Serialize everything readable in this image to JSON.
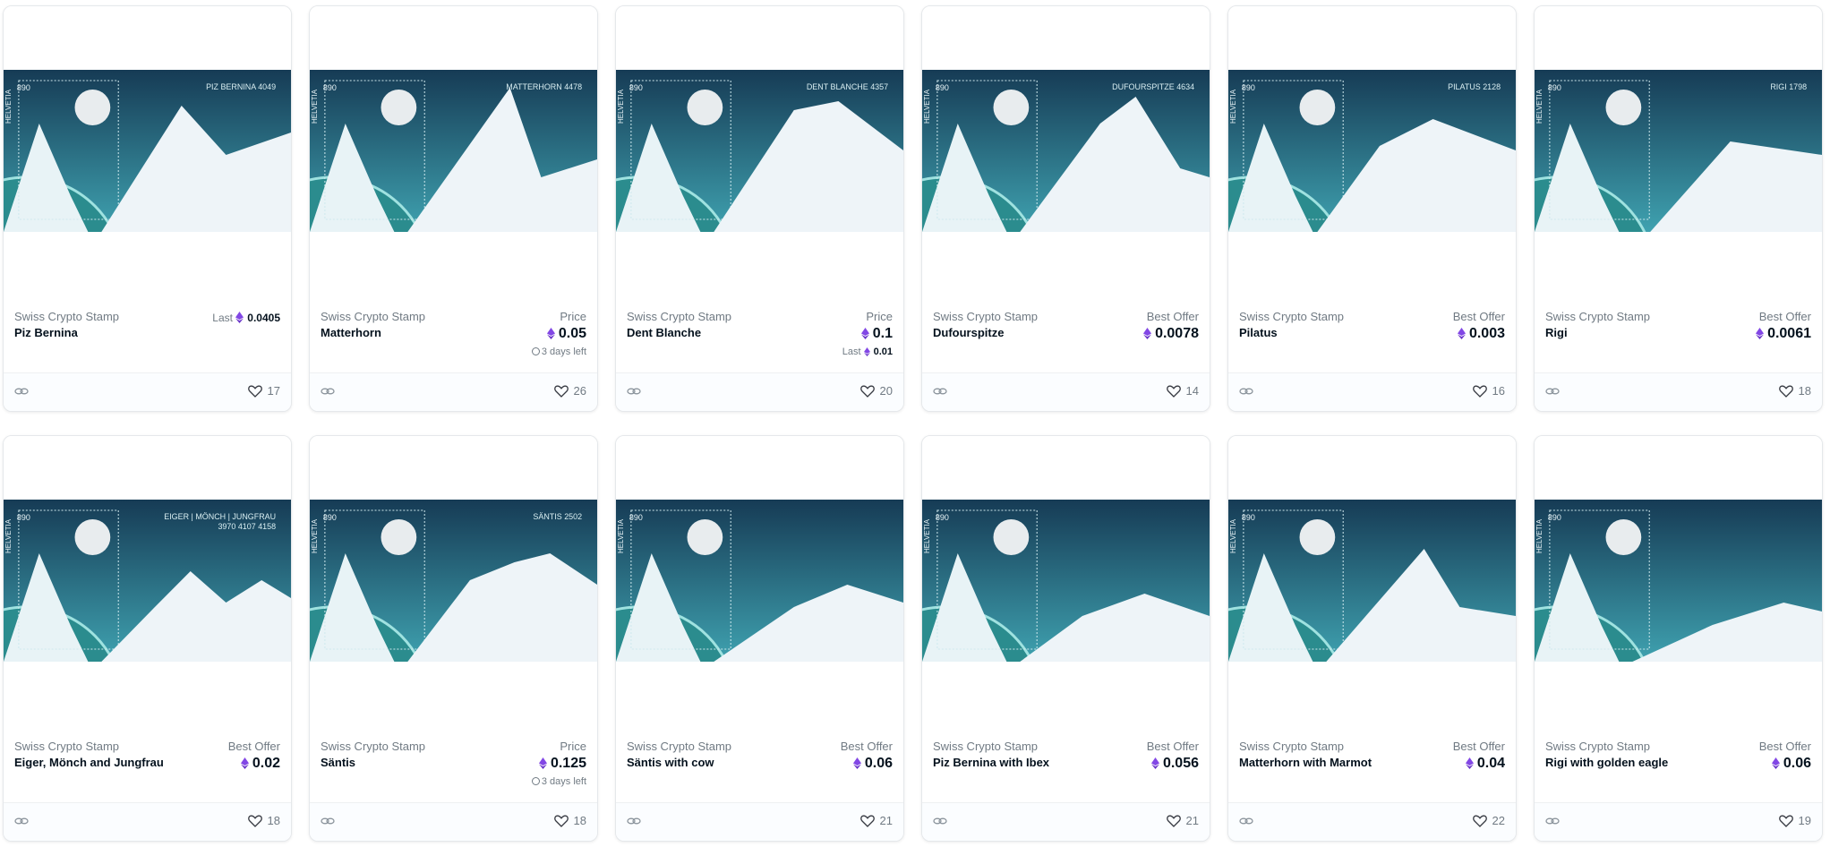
{
  "colors": {
    "accent": "#8247e5",
    "sky_top": "#163b55",
    "sky_bottom": "#3fa2b0",
    "snow": "#eef4f8"
  },
  "icons": {
    "link": "link-icon",
    "like": "heart-icon",
    "currency": "eth-icon",
    "timer": "clock-icon"
  },
  "cards": [
    {
      "collection": "Swiss Crypto Stamp",
      "name": "Piz Bernina",
      "label": "Last",
      "price": "0.0405",
      "extra_text": "",
      "extra_value": "",
      "likes": "17",
      "stamp_value": "890",
      "country": "HELVETIA",
      "peak_text": "PIZ BERNINA 4049",
      "peak_sub": ""
    },
    {
      "collection": "Swiss Crypto Stamp",
      "name": "Matterhorn",
      "label": "Price",
      "price": "0.05",
      "extra_text": "3 days left",
      "extra_value": "",
      "likes": "26",
      "stamp_value": "890",
      "country": "HELVETIA",
      "peak_text": "MATTERHORN 4478",
      "peak_sub": ""
    },
    {
      "collection": "Swiss Crypto Stamp",
      "name": "Dent Blanche",
      "label": "Price",
      "price": "0.1",
      "extra_text": "Last",
      "extra_value": "0.01",
      "likes": "20",
      "stamp_value": "890",
      "country": "HELVETIA",
      "peak_text": "DENT BLANCHE 4357",
      "peak_sub": ""
    },
    {
      "collection": "Swiss Crypto Stamp",
      "name": "Dufourspitze",
      "label": "Best Offer",
      "price": "0.0078",
      "extra_text": "",
      "extra_value": "",
      "likes": "14",
      "stamp_value": "890",
      "country": "HELVETIA",
      "peak_text": "DUFOURSPITZE 4634",
      "peak_sub": ""
    },
    {
      "collection": "Swiss Crypto Stamp",
      "name": "Pilatus",
      "label": "Best Offer",
      "price": "0.003",
      "extra_text": "",
      "extra_value": "",
      "likes": "16",
      "stamp_value": "890",
      "country": "HELVETIA",
      "peak_text": "PILATUS 2128",
      "peak_sub": ""
    },
    {
      "collection": "Swiss Crypto Stamp",
      "name": "Rigi",
      "label": "Best Offer",
      "price": "0.0061",
      "extra_text": "",
      "extra_value": "",
      "likes": "18",
      "stamp_value": "890",
      "country": "HELVETIA",
      "peak_text": "RIGI 1798",
      "peak_sub": ""
    },
    {
      "collection": "Swiss Crypto Stamp",
      "name": "Eiger, Mönch and Jungfrau",
      "label": "Best Offer",
      "price": "0.02",
      "extra_text": "",
      "extra_value": "",
      "likes": "18",
      "stamp_value": "890",
      "country": "HELVETIA",
      "peak_text": "EIGER | MÖNCH | JUNGFRAU",
      "peak_sub": "3970      4107      4158"
    },
    {
      "collection": "Swiss Crypto Stamp",
      "name": "Säntis",
      "label": "Price",
      "price": "0.125",
      "extra_text": "3 days left",
      "extra_value": "",
      "likes": "18",
      "stamp_value": "890",
      "country": "HELVETIA",
      "peak_text": "SÄNTIS 2502",
      "peak_sub": ""
    },
    {
      "collection": "Swiss Crypto Stamp",
      "name": "Säntis with cow",
      "label": "Best Offer",
      "price": "0.06",
      "extra_text": "",
      "extra_value": "",
      "likes": "21",
      "stamp_value": "890",
      "country": "HELVETIA",
      "peak_text": "",
      "peak_sub": ""
    },
    {
      "collection": "Swiss Crypto Stamp",
      "name": "Piz Bernina with Ibex",
      "label": "Best Offer",
      "price": "0.056",
      "extra_text": "",
      "extra_value": "",
      "likes": "21",
      "stamp_value": "890",
      "country": "HELVETIA",
      "peak_text": "",
      "peak_sub": ""
    },
    {
      "collection": "Swiss Crypto Stamp",
      "name": "Matterhorn with Marmot",
      "label": "Best Offer",
      "price": "0.04",
      "extra_text": "",
      "extra_value": "",
      "likes": "22",
      "stamp_value": "890",
      "country": "HELVETIA",
      "peak_text": "",
      "peak_sub": ""
    },
    {
      "collection": "Swiss Crypto Stamp",
      "name": "Rigi with golden eagle",
      "label": "Best Offer",
      "price": "0.06",
      "extra_text": "",
      "extra_value": "",
      "likes": "19",
      "stamp_value": "890",
      "country": "HELVETIA",
      "peak_text": "",
      "peak_sub": ""
    }
  ]
}
